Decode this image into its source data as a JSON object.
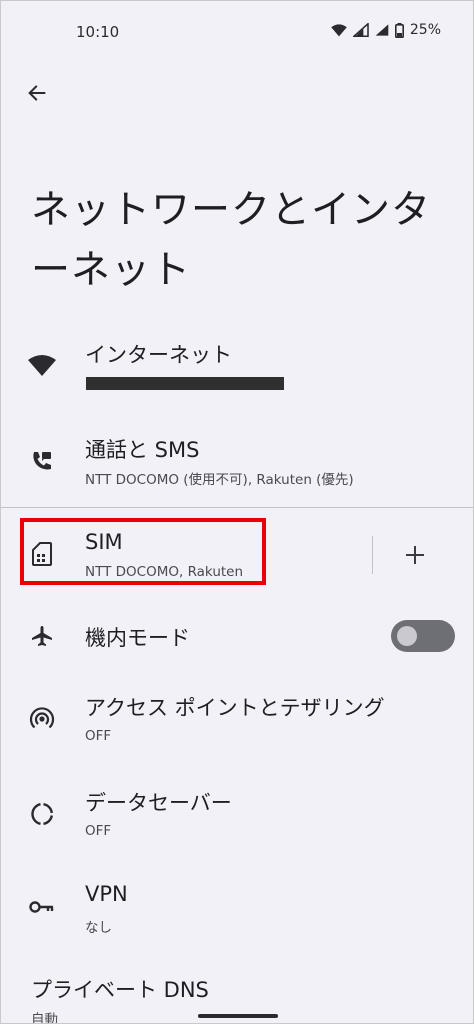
{
  "status_bar": {
    "time": "10:10",
    "battery": "25%"
  },
  "header": {
    "title": "ネットワークとインターネット"
  },
  "items": [
    {
      "id": "internet",
      "title": "インターネット",
      "subtitle": "",
      "icon": "wifi-icon"
    },
    {
      "id": "calls-sms",
      "title": "通話と SMS",
      "subtitle": "NTT DOCOMO (使用不可), Rakuten (優先)",
      "icon": "calls-sms-icon"
    },
    {
      "id": "sim",
      "title": "SIM",
      "subtitle": "NTT DOCOMO, Rakuten",
      "icon": "sim-card-icon"
    },
    {
      "id": "airplane",
      "title": "機内モード",
      "subtitle": "",
      "icon": "airplane-icon",
      "toggle": false
    },
    {
      "id": "hotspot",
      "title": "アクセス ポイントとテザリング",
      "subtitle": "OFF",
      "icon": "hotspot-icon"
    },
    {
      "id": "data-saver",
      "title": "データセーバー",
      "subtitle": "OFF",
      "icon": "data-saver-icon"
    },
    {
      "id": "vpn",
      "title": "VPN",
      "subtitle": "なし",
      "icon": "vpn-key-icon"
    },
    {
      "id": "private-dns",
      "title": "プライベート DNS",
      "subtitle": "自動"
    }
  ],
  "colors": {
    "background": "#f2f1f7",
    "highlight": "#e8000b",
    "toggle_off": "#6e6e75"
  }
}
